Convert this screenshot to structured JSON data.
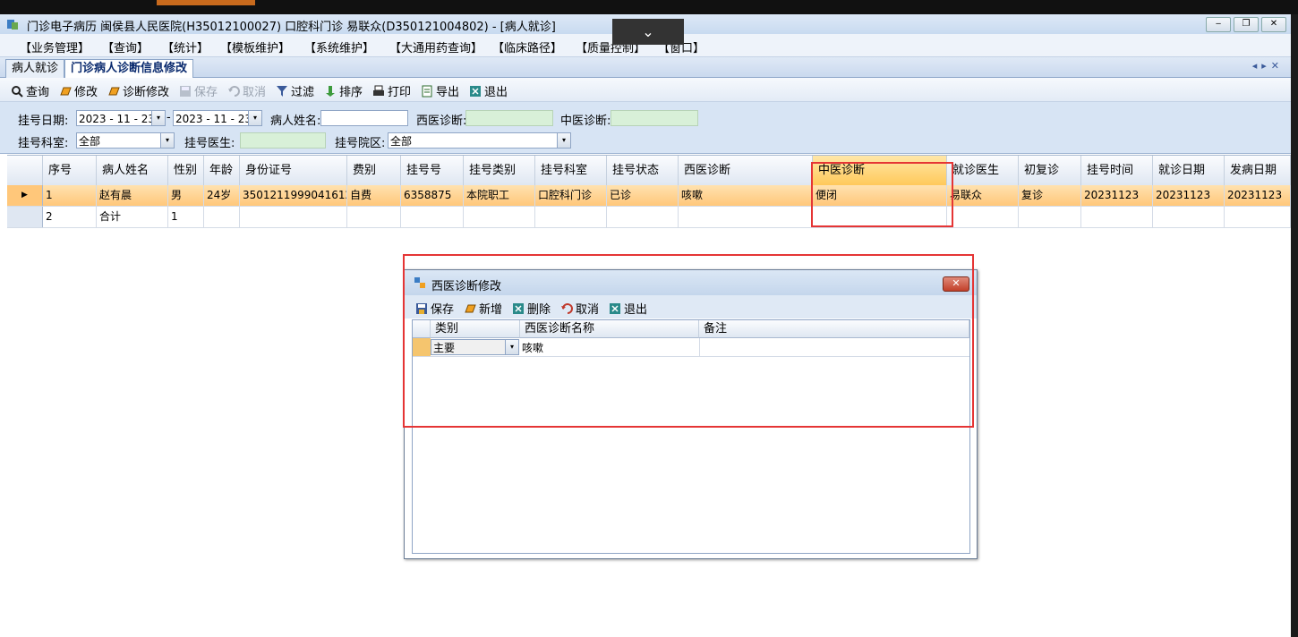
{
  "window": {
    "title": "门诊电子病历  闽侯县人民医院(H35012100027)  口腔科门诊  易联众(D350121004802) - [病人就诊]",
    "controls": [
      "minimize",
      "restore",
      "close"
    ]
  },
  "menu": [
    "【业务管理】",
    "【查询】",
    "【统计】",
    "【模板维护】",
    "【系统维护】",
    "【大通用药查询】",
    "【临床路径】",
    "【质量控制】",
    "【窗口】"
  ],
  "tabs": [
    {
      "label": "病人就诊",
      "active": false
    },
    {
      "label": "门诊病人诊断信息修改",
      "active": true
    }
  ],
  "toolbar": [
    {
      "label": "查询",
      "icon": "magnifier-icon",
      "enabled": true
    },
    {
      "label": "修改",
      "icon": "edit-icon",
      "enabled": true
    },
    {
      "label": "诊断修改",
      "icon": "edit-icon",
      "enabled": true
    },
    {
      "label": "保存",
      "icon": "save-icon",
      "enabled": false
    },
    {
      "label": "取消",
      "icon": "undo-icon",
      "enabled": false
    },
    {
      "label": "过滤",
      "icon": "filter-icon",
      "enabled": true
    },
    {
      "label": "排序",
      "icon": "sort-icon",
      "enabled": true
    },
    {
      "label": "打印",
      "icon": "printer-icon",
      "enabled": true
    },
    {
      "label": "导出",
      "icon": "export-icon",
      "enabled": true
    },
    {
      "label": "退出",
      "icon": "exit-icon",
      "enabled": true
    }
  ],
  "filters": {
    "reg_date_label": "挂号日期:",
    "date_from": "2023 - 11 - 23",
    "date_sep": "-",
    "date_to": "2023 - 11 - 23",
    "patient_name_label": "病人姓名:",
    "patient_name_value": "",
    "western_diag_label": "西医诊断:",
    "western_diag_value": "",
    "tcm_diag_label": "中医诊断:",
    "tcm_diag_value": "",
    "dept_label": "挂号科室:",
    "dept_value": "全部",
    "doctor_label": "挂号医生:",
    "doctor_value": "",
    "campus_label": "挂号院区:",
    "campus_value": "全部"
  },
  "grid": {
    "columns": [
      "序号",
      "病人姓名",
      "性别",
      "年龄",
      "身份证号",
      "费别",
      "挂号号",
      "挂号类别",
      "挂号科室",
      "挂号状态",
      "西医诊断",
      "中医诊断",
      "就诊医生",
      "初复诊",
      "挂号时间",
      "就诊日期",
      "发病日期"
    ],
    "selected_column": "中医诊断",
    "rows": [
      {
        "current": true,
        "cells": [
          "1",
          "赵有晨",
          "男",
          "24岁",
          "350121199904161295",
          "自费",
          "6358875",
          "本院职工",
          "口腔科门诊",
          "已诊",
          "咳嗽",
          "便闭",
          "易联众",
          "复诊",
          "20231123",
          "20231123",
          "20231123"
        ]
      },
      {
        "current": false,
        "cells": [
          "2",
          "合计",
          "1",
          "",
          "",
          "",
          "",
          "",
          "",
          "",
          "",
          "",
          "",
          "",
          "",
          "",
          ""
        ]
      }
    ]
  },
  "dialog": {
    "title": "西医诊断修改",
    "close_label": "✕",
    "toolbar": [
      {
        "label": "保存",
        "icon": "save-icon"
      },
      {
        "label": "新增",
        "icon": "edit-icon"
      },
      {
        "label": "删除",
        "icon": "delete-icon"
      },
      {
        "label": "取消",
        "icon": "undo-icon"
      },
      {
        "label": "退出",
        "icon": "exit-icon"
      }
    ],
    "columns": [
      "类别",
      "西医诊断名称",
      "备注"
    ],
    "rows": [
      {
        "category": "主要",
        "diagnosis": "咳嗽",
        "note": ""
      }
    ]
  },
  "colors": {
    "selected_row": "#ffc77a",
    "highlight_box": "#e53535",
    "filter_bg": "#d7e4f4",
    "green_field": "#d8f0d8"
  }
}
